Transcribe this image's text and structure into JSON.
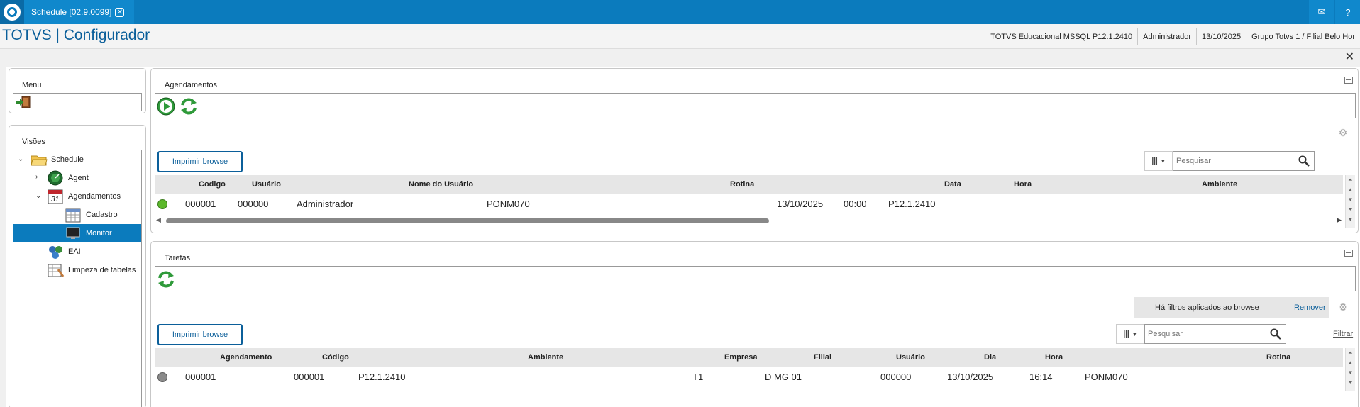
{
  "window": {
    "tab_title": "Schedule [02.9.0099]",
    "app_title": "TOTVS | Configurador"
  },
  "header_info": {
    "database": "TOTVS Educacional MSSQL P12.1.2410",
    "user": "Administrador",
    "date": "13/10/2025",
    "branch": "Grupo Totvs 1 / Filial Belo Hor"
  },
  "menu_panel": {
    "title": "Menu"
  },
  "visoes_panel": {
    "title": "Visões",
    "tree": [
      {
        "label": "Schedule"
      },
      {
        "label": "Agent"
      },
      {
        "label": "Agendamentos"
      },
      {
        "label": "Cadastro"
      },
      {
        "label": "Monitor"
      },
      {
        "label": "EAI"
      },
      {
        "label": "Limpeza de tabelas"
      }
    ]
  },
  "agendamentos": {
    "title": "Agendamentos",
    "print_button": "Imprimir browse",
    "search_placeholder": "Pesquisar",
    "columns": [
      "Codigo",
      "Usuário",
      "Nome do Usuário",
      "Rotina",
      "Data",
      "Hora",
      "Ambiente"
    ],
    "rows": [
      {
        "status": "green",
        "codigo": "000001",
        "usuario": "000000",
        "nome": "Administrador",
        "rotina": "PONM070",
        "data": "13/10/2025",
        "hora": "00:00",
        "ambiente": "P12.1.2410"
      }
    ]
  },
  "tarefas": {
    "title": "Tarefas",
    "print_button": "Imprimir browse",
    "search_placeholder": "Pesquisar",
    "filters_applied": "Há filtros aplicados ao browse",
    "remove_label": "Remover",
    "filter_label": "Filtrar",
    "columns": [
      "Agendamento",
      "Código",
      "Ambiente",
      "Empresa",
      "Filial",
      "Usuário",
      "Dia",
      "Hora",
      "Rotina"
    ],
    "rows": [
      {
        "status": "gray",
        "agendamento": "000001",
        "codigo": "000001",
        "ambiente": "P12.1.2410",
        "empresa": "T1",
        "filial": "D MG 01",
        "usuario": "000000",
        "dia": "13/10/2025",
        "hora": "16:14",
        "rotina": "PONM070"
      }
    ]
  },
  "colors": {
    "topbar": "#0b7bbd",
    "title": "#0b5f9a",
    "selected": "#0b7bbd",
    "status_green": "#5cb82b",
    "status_gray": "#8a8a8a"
  }
}
